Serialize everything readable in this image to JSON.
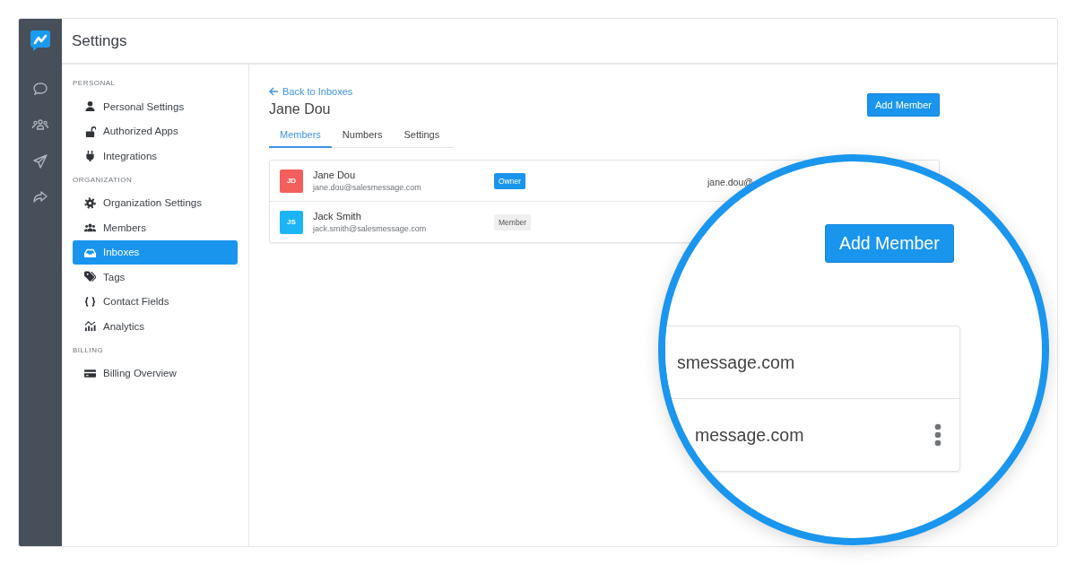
{
  "app": {
    "title": "Settings"
  },
  "sidebar": {
    "sections": [
      {
        "heading": "PERSONAL",
        "items": [
          {
            "label": "Personal Settings",
            "selected": false
          },
          {
            "label": "Authorized Apps",
            "selected": false
          },
          {
            "label": "Integrations",
            "selected": false
          }
        ]
      },
      {
        "heading": "ORGANIZATION",
        "items": [
          {
            "label": "Organization Settings",
            "selected": false
          },
          {
            "label": "Members",
            "selected": false
          },
          {
            "label": "Inboxes",
            "selected": true
          },
          {
            "label": "Tags",
            "selected": false
          },
          {
            "label": "Contact Fields",
            "selected": false
          },
          {
            "label": "Analytics",
            "selected": false
          }
        ]
      },
      {
        "heading": "BILLING",
        "items": [
          {
            "label": "Billing Overview",
            "selected": false
          }
        ]
      }
    ]
  },
  "page": {
    "back_link": "Back to Inboxes",
    "title": "Jane Dou",
    "add_button": "Add Member",
    "tabs": [
      {
        "label": "Members",
        "selected": true
      },
      {
        "label": "Numbers",
        "selected": false
      },
      {
        "label": "Settings",
        "selected": false
      }
    ],
    "members": [
      {
        "initials": "JD",
        "color": "#f25f5c",
        "name": "Jane Dou",
        "email": "jane.dou@salesmessage.com",
        "role": "Owner",
        "kind": "owner",
        "column_4": "jane.dou@"
      },
      {
        "initials": "JS",
        "color": "#1bb5f5",
        "name": "Jack Smith",
        "email": "jack.smith@salesmessage.com",
        "role": "Member",
        "kind": "member"
      }
    ]
  },
  "magnifier": {
    "button": "Add Member",
    "rows": [
      {
        "text": "smessage.com",
        "menu": false
      },
      {
        "text": "message.com",
        "menu": true
      }
    ]
  }
}
